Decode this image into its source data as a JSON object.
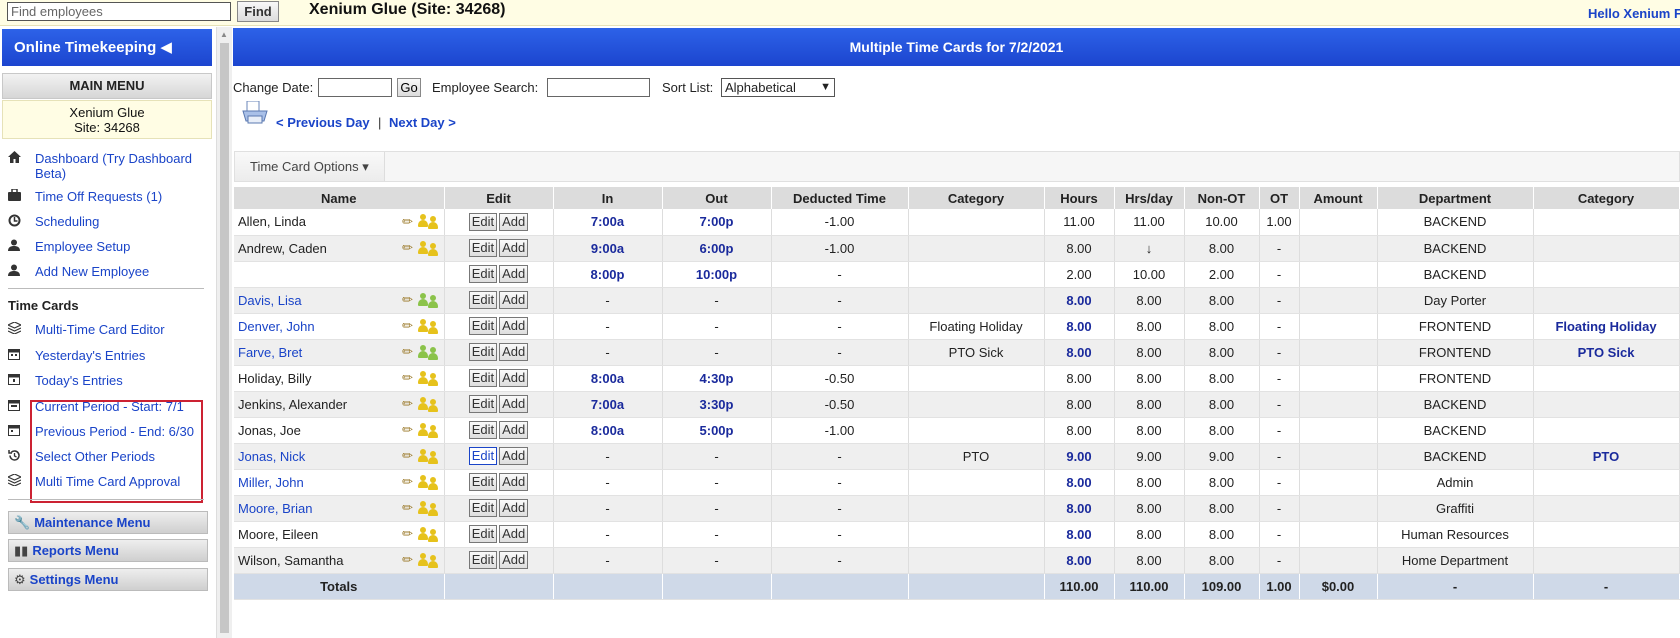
{
  "topbar": {
    "find_placeholder": "Find employees",
    "find_button": "Find",
    "company_title": "Xenium Glue (Site: 34268)",
    "greeting": "Hello Xenium F"
  },
  "sidebar": {
    "header": "Online Timekeeping ◀",
    "main_menu": "MAIN MENU",
    "site_name": "Xenium Glue",
    "site_id": "Site: 34268",
    "items": [
      {
        "label": "Dashboard (Try Dashboard Beta)",
        "icon": "home-icon"
      },
      {
        "label": "Time Off Requests (1)",
        "icon": "briefcase-icon"
      },
      {
        "label": "Scheduling",
        "icon": "scheduling-icon"
      },
      {
        "label": "Employee Setup",
        "icon": "user-icon"
      },
      {
        "label": "Add New Employee",
        "icon": "user-add-icon"
      }
    ],
    "timecards_title": "Time Cards",
    "timecard_items": [
      {
        "label": "Multi-Time Card Editor",
        "icon": "layers-icon"
      },
      {
        "label": "Yesterday's Entries",
        "icon": "calendar-icon"
      },
      {
        "label": "Today's Entries",
        "icon": "calendar-icon"
      },
      {
        "label": "Current Period - Start: 7/1",
        "icon": "calendar-icon"
      },
      {
        "label": "Previous Period - End: 6/30",
        "icon": "calendar-icon"
      },
      {
        "label": "Select Other Periods",
        "icon": "history-icon"
      },
      {
        "label": "Multi Time Card Approval",
        "icon": "layers-icon"
      }
    ],
    "bottom_menus": [
      {
        "label": "Maintenance Menu",
        "icon": "wrench-icon"
      },
      {
        "label": "Reports Menu",
        "icon": "bar-chart-icon"
      },
      {
        "label": "Settings Menu",
        "icon": "gear-icon"
      }
    ]
  },
  "main": {
    "title": "Multiple Time Cards for 7/2/2021",
    "change_date_label": "Change Date:",
    "go_button": "Go",
    "employee_search_label": "Employee Search:",
    "sort_list_label": "Sort List:",
    "sort_selected": "Alphabetical",
    "prev_day": "< Previous Day",
    "separator": "|",
    "next_day": "Next Day >",
    "time_card_options": "Time Card Options ▾"
  },
  "table": {
    "columns": [
      "Name",
      "Edit",
      "In",
      "Out",
      "Deducted Time",
      "Category",
      "Hours",
      "Hrs/day",
      "Non-OT",
      "OT",
      "Amount",
      "Department",
      "Category"
    ],
    "edit_label": "Edit",
    "add_label": "Add",
    "rows": [
      {
        "name": "Allen, Linda",
        "linked": false,
        "people": "yellow",
        "in": "7:00a",
        "out": "7:00p",
        "deducted": "-1.00",
        "category": "",
        "hours": "11.00",
        "hours_bold": false,
        "hrsday": "11.00",
        "nonot": "10.00",
        "ot": "1.00",
        "amount": "",
        "dept": "BACKEND",
        "category2": ""
      },
      {
        "name": "Andrew, Caden",
        "linked": false,
        "people": "yellow",
        "in": "9:00a",
        "out": "6:00p",
        "deducted": "-1.00",
        "category": "",
        "hours": "8.00",
        "hours_bold": false,
        "hrsday": "↓",
        "nonot": "8.00",
        "ot": "-",
        "amount": "",
        "dept": "BACKEND",
        "category2": ""
      },
      {
        "name": "",
        "linked": false,
        "people": "",
        "in": "8:00p",
        "out": "10:00p",
        "deducted": "-",
        "category": "",
        "hours": "2.00",
        "hours_bold": false,
        "hrsday": "10.00",
        "nonot": "2.00",
        "ot": "-",
        "amount": "",
        "dept": "BACKEND",
        "category2": ""
      },
      {
        "name": "Davis, Lisa",
        "linked": true,
        "people": "green",
        "in": "-",
        "out": "-",
        "deducted": "-",
        "category": "",
        "hours": "8.00",
        "hours_bold": true,
        "hrsday": "8.00",
        "nonot": "8.00",
        "ot": "-",
        "amount": "",
        "dept": "Day Porter",
        "category2": ""
      },
      {
        "name": "Denver, John",
        "linked": true,
        "people": "yellow",
        "in": "-",
        "out": "-",
        "deducted": "-",
        "category": "Floating Holiday",
        "hours": "8.00",
        "hours_bold": true,
        "hrsday": "8.00",
        "nonot": "8.00",
        "ot": "-",
        "amount": "",
        "dept": "FRONTEND",
        "category2": "Floating Holiday"
      },
      {
        "name": "Farve, Bret",
        "linked": true,
        "people": "green",
        "in": "-",
        "out": "-",
        "deducted": "-",
        "category": "PTO Sick",
        "hours": "8.00",
        "hours_bold": true,
        "hrsday": "8.00",
        "nonot": "8.00",
        "ot": "-",
        "amount": "",
        "dept": "FRONTEND",
        "category2": "PTO Sick"
      },
      {
        "name": "Holiday, Billy",
        "linked": false,
        "people": "yellow",
        "in": "8:00a",
        "out": "4:30p",
        "deducted": "-0.50",
        "category": "",
        "hours": "8.00",
        "hours_bold": false,
        "hrsday": "8.00",
        "nonot": "8.00",
        "ot": "-",
        "amount": "",
        "dept": "FRONTEND",
        "category2": ""
      },
      {
        "name": "Jenkins, Alexander",
        "linked": false,
        "people": "yellow",
        "in": "7:00a",
        "out": "3:30p",
        "deducted": "-0.50",
        "category": "",
        "hours": "8.00",
        "hours_bold": false,
        "hrsday": "8.00",
        "nonot": "8.00",
        "ot": "-",
        "amount": "",
        "dept": "BACKEND",
        "category2": ""
      },
      {
        "name": "Jonas, Joe",
        "linked": false,
        "people": "yellow",
        "in": "8:00a",
        "out": "5:00p",
        "deducted": "-1.00",
        "category": "",
        "hours": "8.00",
        "hours_bold": false,
        "hrsday": "8.00",
        "nonot": "8.00",
        "ot": "-",
        "amount": "",
        "dept": "BACKEND",
        "category2": ""
      },
      {
        "name": "Jonas, Nick",
        "linked": true,
        "people": "yellow",
        "edit_active": true,
        "in": "-",
        "out": "-",
        "deducted": "-",
        "category": "PTO",
        "hours": "9.00",
        "hours_bold": true,
        "hrsday": "9.00",
        "nonot": "9.00",
        "ot": "-",
        "amount": "",
        "dept": "BACKEND",
        "category2": "PTO"
      },
      {
        "name": "Miller, John",
        "linked": true,
        "people": "yellow",
        "in": "-",
        "out": "-",
        "deducted": "-",
        "category": "",
        "hours": "8.00",
        "hours_bold": true,
        "hrsday": "8.00",
        "nonot": "8.00",
        "ot": "-",
        "amount": "",
        "dept": "Admin",
        "category2": ""
      },
      {
        "name": "Moore, Brian",
        "linked": true,
        "people": "yellow",
        "in": "-",
        "out": "-",
        "deducted": "-",
        "category": "",
        "hours": "8.00",
        "hours_bold": true,
        "hrsday": "8.00",
        "nonot": "8.00",
        "ot": "-",
        "amount": "",
        "dept": "Graffiti",
        "category2": ""
      },
      {
        "name": "Moore, Eileen",
        "linked": false,
        "people": "yellow",
        "in": "-",
        "out": "-",
        "deducted": "-",
        "category": "",
        "hours": "8.00",
        "hours_bold": true,
        "hrsday": "8.00",
        "nonot": "8.00",
        "ot": "-",
        "amount": "",
        "dept": "Human Resources",
        "category2": ""
      },
      {
        "name": "Wilson, Samantha",
        "linked": false,
        "people": "yellow",
        "in": "-",
        "out": "-",
        "deducted": "-",
        "category": "",
        "hours": "8.00",
        "hours_bold": true,
        "hrsday": "8.00",
        "nonot": "8.00",
        "ot": "-",
        "amount": "",
        "dept": "Home Department",
        "category2": ""
      }
    ],
    "totals": {
      "label": "Totals",
      "hours": "110.00",
      "hrsday": "110.00",
      "nonot": "109.00",
      "ot": "1.00",
      "amount": "$0.00",
      "dept": "-",
      "category2": "-"
    }
  },
  "colors": {
    "header_blue": "#1c45cf",
    "link_blue": "#1a44c8",
    "highlight_red": "#cc2233",
    "totals_bg": "#cfd9e8"
  }
}
